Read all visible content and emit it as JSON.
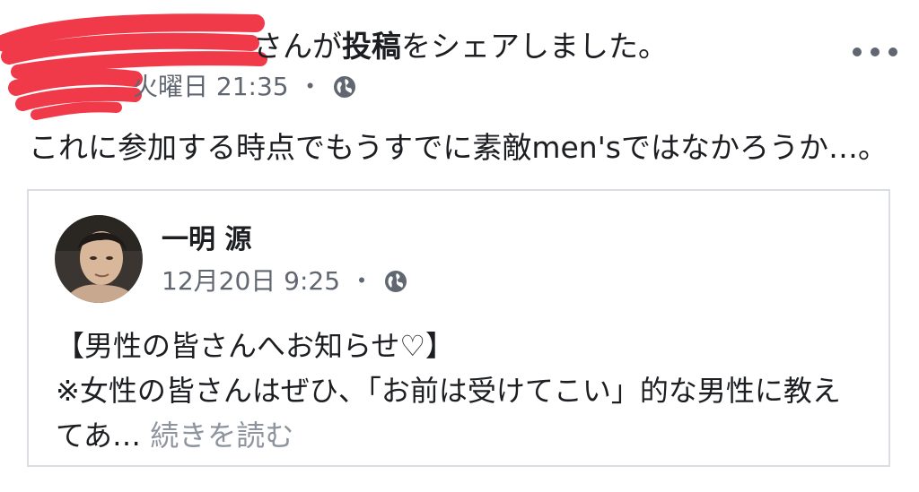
{
  "header": {
    "share_text_prefix": "さんが",
    "share_text_bold": "投稿",
    "share_text_suffix": "をシェアしました。",
    "timestamp": "火曜日 21:35",
    "separator": "・",
    "privacy_icon": "globe-icon",
    "more_icon": "more-horizontal-icon"
  },
  "post": {
    "text": "これに参加する時点でもうすでに素敵men'sではなかろうか…。"
  },
  "shared": {
    "author_name": "一明 源",
    "timestamp": "12月20日 9:25",
    "separator": "・",
    "privacy_icon": "globe-icon",
    "body_line1": "【男性の皆さんへお知らせ♡】",
    "body_line2": "※女性の皆さんはぜひ、「お前は受けてこい」的な男性に教え",
    "body_line3": "てあ… ",
    "see_more": "続きを読む"
  },
  "colors": {
    "redaction": "#f03a4a",
    "text": "#1c1e21",
    "secondary": "#606770",
    "see_more": "#8d949e",
    "border": "#dadde1"
  }
}
